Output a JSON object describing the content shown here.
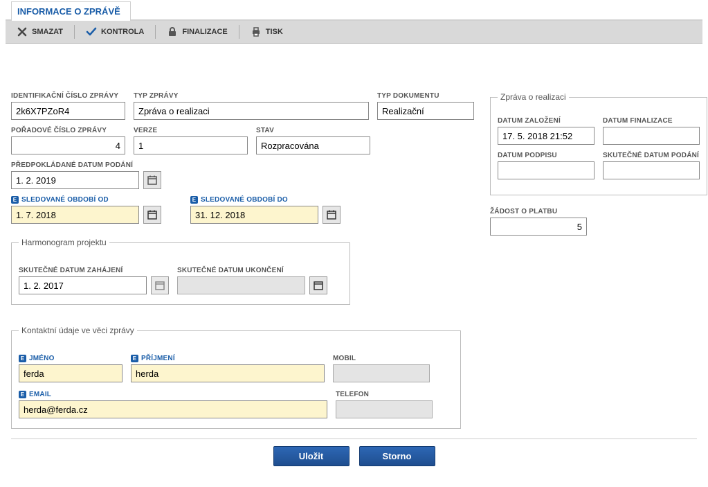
{
  "tab": {
    "title": "INFORMACE O ZPRÁVĚ"
  },
  "toolbar": {
    "delete": "SMAZAT",
    "check": "KONTROLA",
    "finalize": "FINALIZACE",
    "print": "TISK"
  },
  "fields": {
    "id_label": "IDENTIFIKAČNÍ ČÍSLO ZPRÁVY",
    "id_value": "2k6X7PZoR4",
    "type_label": "TYP ZPRÁVY",
    "type_value": "Zpráva o realizaci",
    "doctype_label": "TYP DOKUMENTU",
    "doctype_value": "Realizační",
    "order_label": "POŘADOVÉ ČÍSLO ZPRÁVY",
    "order_value": "4",
    "version_label": "VERZE",
    "version_value": "1",
    "state_label": "STAV",
    "state_value": "Rozpracována",
    "expected_label": "PŘEDPOKLÁDANÉ DATUM PODÁNÍ",
    "expected_value": "1. 2. 2019",
    "period_from_label": "SLEDOVANÉ OBDOBÍ OD",
    "period_from_value": "1. 7. 2018",
    "period_to_label": "SLEDOVANÉ OBDOBÍ DO",
    "period_to_value": "31. 12. 2018"
  },
  "realization": {
    "legend": "Zpráva o realizaci",
    "created_label": "DATUM ZALOŽENÍ",
    "created_value": "17. 5. 2018 21:52",
    "final_label": "DATUM FINALIZACE",
    "final_value": "",
    "sign_label": "DATUM PODPISU",
    "sign_value": "",
    "actual_submit_label": "SKUTEČNÉ DATUM PODÁNÍ",
    "actual_submit_value": ""
  },
  "payment": {
    "label": "ŽÁDOST O PLATBU",
    "value": "5"
  },
  "harmonogram": {
    "legend": "Harmonogram projektu",
    "start_label": "SKUTEČNÉ DATUM ZAHÁJENÍ",
    "start_value": "1. 2. 2017",
    "end_label": "SKUTEČNÉ DATUM UKONČENÍ",
    "end_value": ""
  },
  "contact": {
    "legend": "Kontaktní údaje ve věci zprávy",
    "firstname_label": "JMÉNO",
    "firstname_value": "ferda",
    "lastname_label": "PŘÍJMENÍ",
    "lastname_value": "herda",
    "mobile_label": "MOBIL",
    "mobile_value": "",
    "email_label": "EMAIL",
    "email_value": "herda@ferda.cz",
    "phone_label": "TELEFON",
    "phone_value": ""
  },
  "buttons": {
    "save": "Uložit",
    "cancel": "Storno"
  }
}
